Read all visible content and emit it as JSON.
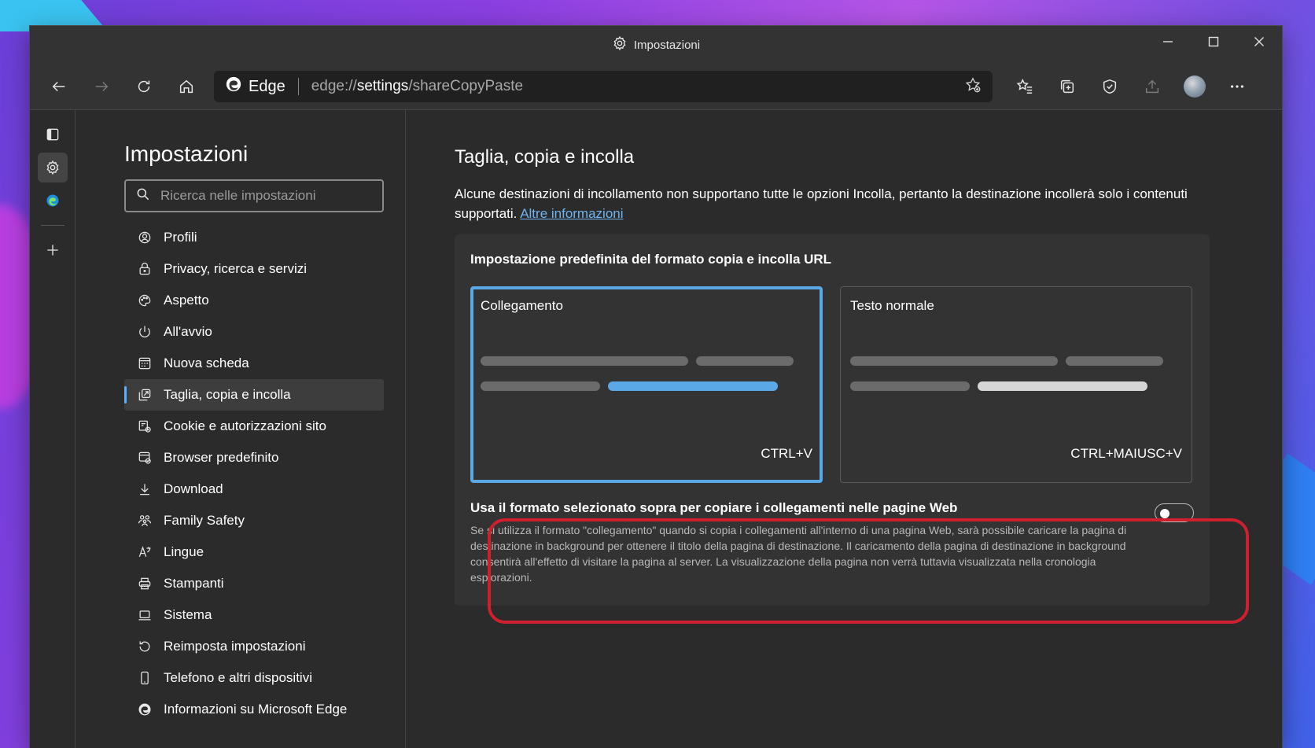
{
  "window": {
    "title": "Impostazioni"
  },
  "address": {
    "brand": "Edge",
    "url_prefix": "edge://",
    "url_host": "settings",
    "url_path": "/shareCopyPaste"
  },
  "sidebar": {
    "title": "Impostazioni",
    "search_placeholder": "Ricerca nelle impostazioni",
    "items": [
      {
        "label": "Profili",
        "icon": "profile-icon"
      },
      {
        "label": "Privacy, ricerca e servizi",
        "icon": "lock-icon"
      },
      {
        "label": "Aspetto",
        "icon": "palette-icon"
      },
      {
        "label": "All'avvio",
        "icon": "power-icon"
      },
      {
        "label": "Nuova scheda",
        "icon": "new-tab-icon"
      },
      {
        "label": "Taglia, copia e incolla",
        "icon": "share-copy-icon",
        "active": true
      },
      {
        "label": "Cookie e autorizzazioni sito",
        "icon": "cookie-icon"
      },
      {
        "label": "Browser predefinito",
        "icon": "default-browser-icon"
      },
      {
        "label": "Download",
        "icon": "download-icon"
      },
      {
        "label": "Family Safety",
        "icon": "family-icon"
      },
      {
        "label": "Lingue",
        "icon": "language-icon"
      },
      {
        "label": "Stampanti",
        "icon": "printer-icon"
      },
      {
        "label": "Sistema",
        "icon": "laptop-icon"
      },
      {
        "label": "Reimposta impostazioni",
        "icon": "reset-icon"
      },
      {
        "label": "Telefono e altri dispositivi",
        "icon": "phone-icon"
      },
      {
        "label": "Informazioni su Microsoft Edge",
        "icon": "edge-icon"
      }
    ]
  },
  "main": {
    "title": "Taglia, copia e incolla",
    "description": "Alcune destinazioni di incollamento non supportano tutte le opzioni Incolla, pertanto la destinazione incollerà solo i contenuti supportati.",
    "more_info_link": "Altre informazioni",
    "card": {
      "title": "Impostazione predefinita del formato copia e incolla URL",
      "options": [
        {
          "label": "Collegamento",
          "shortcut": "CTRL+V",
          "selected": true
        },
        {
          "label": "Testo normale",
          "shortcut": "CTRL+MAIUSC+V",
          "selected": false
        }
      ],
      "setting": {
        "title": "Usa il formato selezionato sopra per copiare i collegamenti nelle pagine Web",
        "description": "Se si utilizza il formato \"collegamento\" quando si copia i collegamenti all'interno di una pagina Web, sarà possibile caricare la pagina di destinazione in background per ottenere il titolo della pagina di destinazione. Il caricamento della pagina di destinazione in background consentirà all'effetto di visitare la pagina al server. La visualizzazione della pagina non verrà tuttavia visualizzata nella cronologia esplorazioni.",
        "enabled": false
      }
    }
  },
  "colors": {
    "accent": "#5aa9e6",
    "highlight": "#d01f2e",
    "link": "#6fb4f0"
  }
}
